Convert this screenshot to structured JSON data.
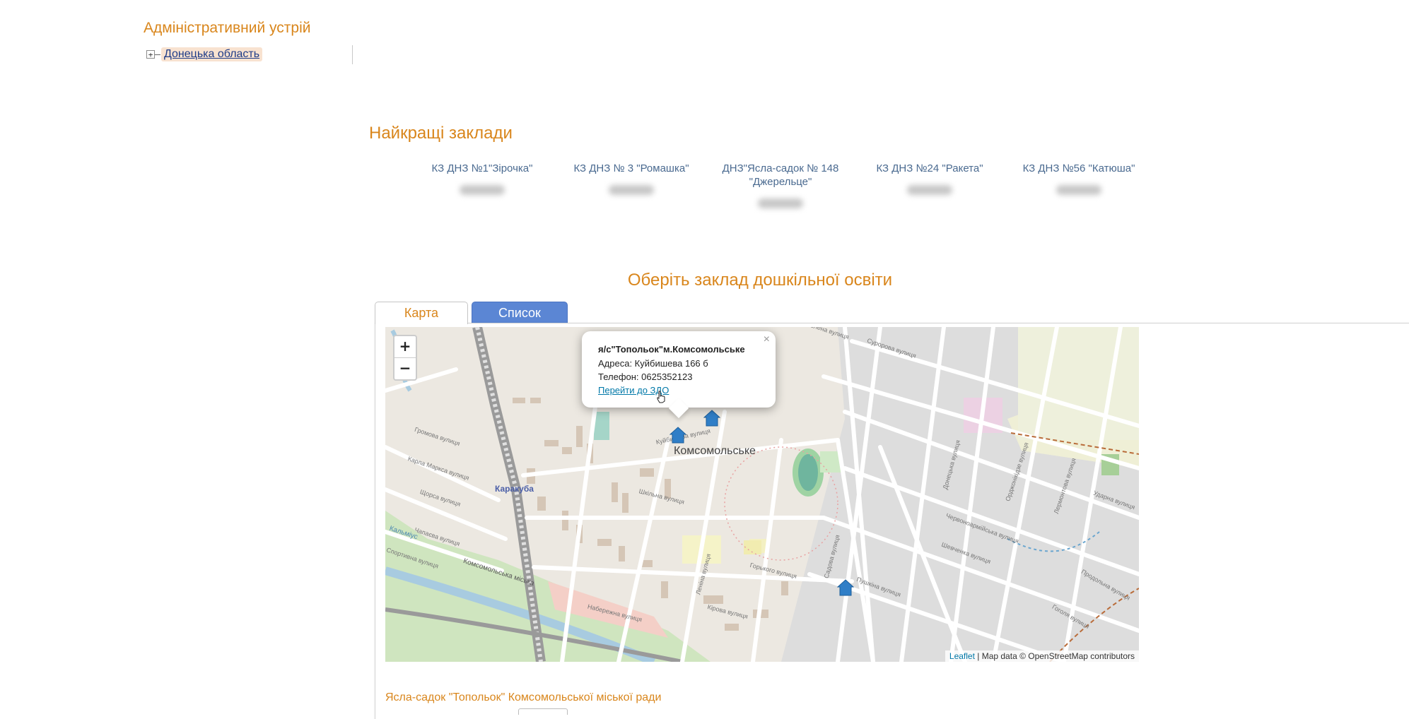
{
  "admin": {
    "title": "Адміністративний устрій",
    "tree_toggle": "+",
    "region": "Донецька область"
  },
  "best": {
    "title": "Найкращі заклади",
    "items": [
      {
        "name": "КЗ ДНЗ №1\"Зірочка\""
      },
      {
        "name": "КЗ ДНЗ № 3 \"Ромашка\""
      },
      {
        "name": "ДНЗ\"Ясла-садок № 148 \"Джерельце\""
      },
      {
        "name": "КЗ ДНЗ №24 \"Ракета\""
      },
      {
        "name": "КЗ ДНЗ №56 \"Катюша\""
      }
    ]
  },
  "choose": {
    "title": "Оберіть заклад дошкільної освіти",
    "tabs": [
      {
        "label": "Карта",
        "active": true
      },
      {
        "label": "Список",
        "active": false
      }
    ]
  },
  "map": {
    "zoom_in": "+",
    "zoom_out": "−",
    "city_label": "Комсомольське",
    "district_label": "Каракуба",
    "river_label": "Кальміус",
    "street_label": "Комсомольська міська",
    "popup": {
      "close": "×",
      "name": "я/с\"Топольок\"м.Комсомольське",
      "address": "Адреса: Куйбишева 166 б",
      "phone": "Телефон: 0625352123",
      "link": "Перейти до ЗДО"
    },
    "attribution": {
      "leaflet": "Leaflet",
      "rest": " | Map data © OpenStreetMap contributors"
    },
    "streets": [
      "Суророва вулиця",
      "Зелена вулиця",
      "Громова вулиця",
      "Карла Маркса вулиця",
      "Щорса вулиця",
      "Чапаєва вулиця",
      "Спортивна вулиця",
      "Горького вулиця",
      "Куйбишева вулиця",
      "Шкільна вулиця",
      "Донецька вулиця",
      "Садова вулиця",
      "Пушкіна вулиця",
      "Шевченка вулиця",
      "Червоноармійська вулиця",
      "Лермонтова вулиця",
      "Набережна вулиця",
      "Кірова вулиця",
      "Леніна вулиця",
      "Гоголя вулиця",
      "Продольна вулиця",
      "Орджонікідзе вулиця",
      "Ударна вулиця"
    ]
  },
  "bottom": {
    "title": "Ясла-садок \"Топольок\" Комсомольської міської ради"
  },
  "colors": {
    "accent": "#d9861c",
    "tab_active_bg": "#5b86d4",
    "marker": "#2f7ec7",
    "link": "#0078a8"
  }
}
